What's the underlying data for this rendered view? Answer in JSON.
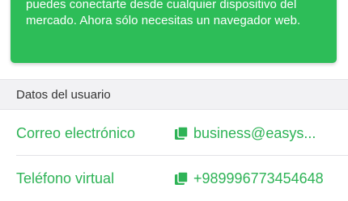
{
  "banner": {
    "text": "puedes conectarte desde cualquier dispositivo del mercado. Ahora sólo necesitas un navegador web."
  },
  "section": {
    "title": "Datos del usuario"
  },
  "rows": [
    {
      "label": "Correo electrónico",
      "value": "business@easys...",
      "icon": "copy-icon"
    },
    {
      "label": "Teléfono virtual",
      "value": "+989996773454648",
      "icon": "copy-icon"
    }
  ],
  "colors": {
    "accent": "#2dbd58",
    "text_green": "#2eb356",
    "header_bg": "#f2f2f4"
  }
}
